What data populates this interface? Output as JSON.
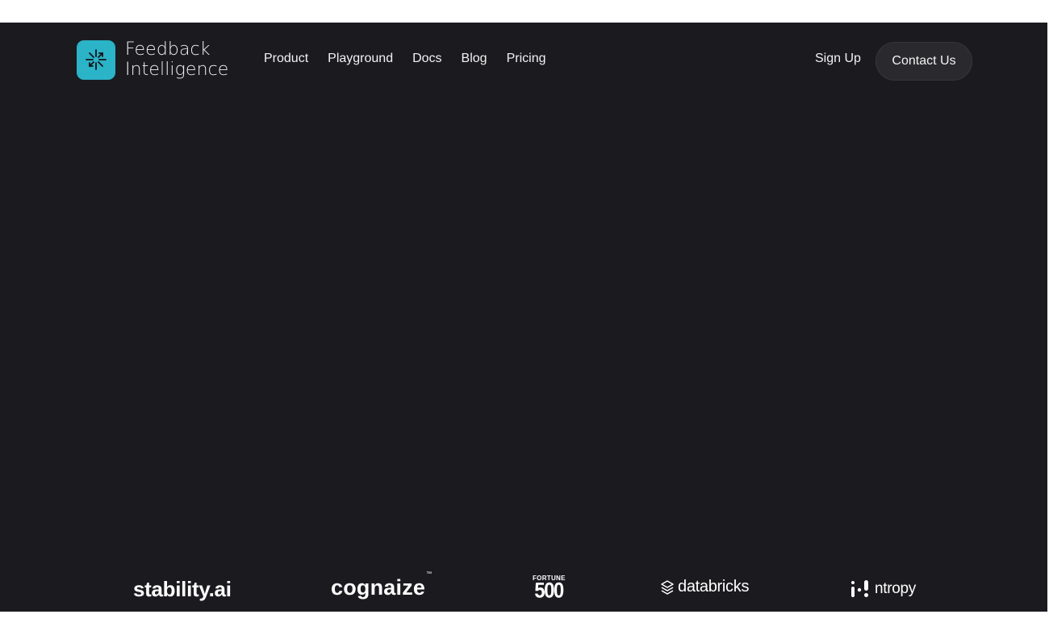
{
  "brand": {
    "name_line1": "Feedback",
    "name_line2": "Intelligence",
    "logo_icon": "sparkle-icon",
    "accent_color": "#2bb3c7"
  },
  "nav": {
    "links": [
      {
        "label": "Product"
      },
      {
        "label": "Playground"
      },
      {
        "label": "Docs"
      },
      {
        "label": "Blog"
      },
      {
        "label": "Pricing"
      }
    ],
    "sign_up_label": "Sign Up",
    "contact_label": "Contact Us"
  },
  "customer_logos": {
    "stability": "stability.ai",
    "cognaize": "cognaize",
    "cognaize_tm": "™",
    "fortune_top": "FORTUNE",
    "fortune_num": "500",
    "databricks": "databricks",
    "databricks_icon": "stacked-layers-icon",
    "ntropy": "ntropy",
    "ntropy_icon": "ntropy-mark-icon"
  },
  "colors": {
    "background": "#1b1b1f",
    "text": "#f2f2f2",
    "button_bg": "#2a2a2e"
  }
}
